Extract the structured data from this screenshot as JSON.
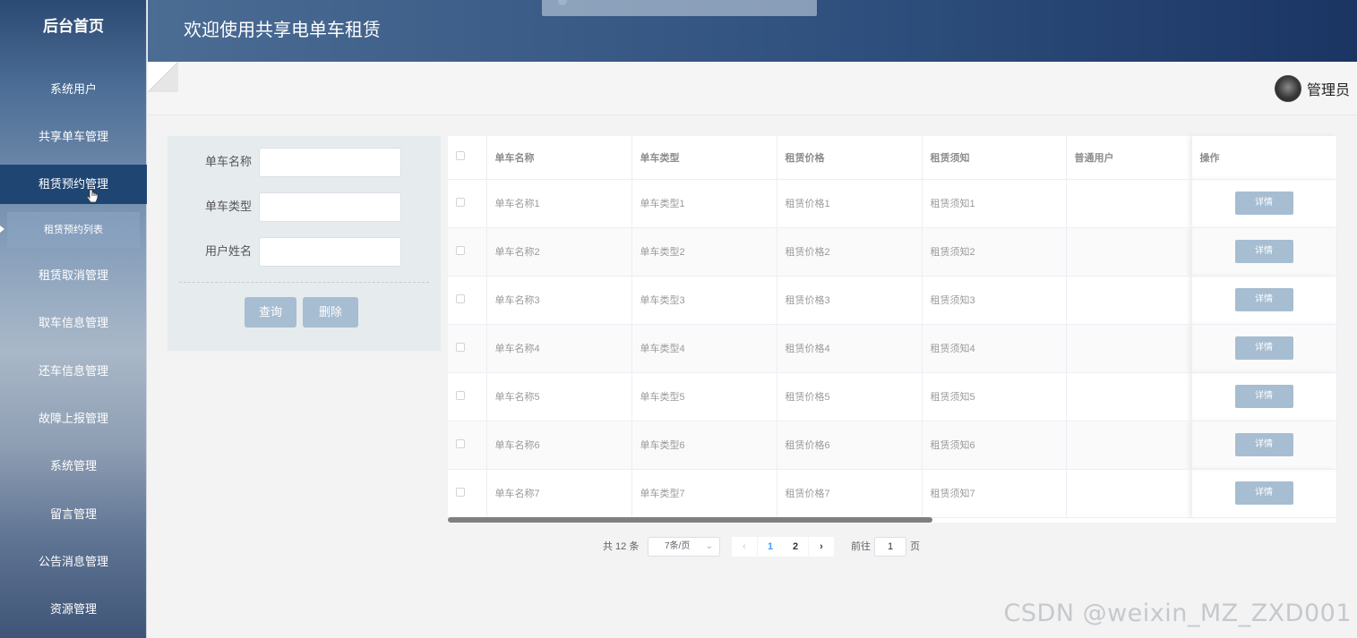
{
  "sidebar": {
    "title": "后台首页",
    "items": [
      {
        "label": "系统用户"
      },
      {
        "label": "共享单车管理"
      },
      {
        "label": "租赁预约管理"
      },
      {
        "label": "租赁取消管理"
      },
      {
        "label": "取车信息管理"
      },
      {
        "label": "还车信息管理"
      },
      {
        "label": "故障上报管理"
      },
      {
        "label": "系统管理"
      },
      {
        "label": "留言管理"
      },
      {
        "label": "公告消息管理"
      },
      {
        "label": "资源管理"
      }
    ],
    "active_index": 2,
    "submenu": {
      "label": "租赁预约列表"
    }
  },
  "header": {
    "title": "欢迎使用共享电单车租赁"
  },
  "topbar": {
    "user_name": "管理员"
  },
  "search": {
    "fields": [
      {
        "label": "单车名称",
        "value": ""
      },
      {
        "label": "单车类型",
        "value": ""
      },
      {
        "label": "用户姓名",
        "value": ""
      }
    ],
    "query_label": "查询",
    "delete_label": "删除"
  },
  "table": {
    "columns": [
      "单车名称",
      "单车类型",
      "租赁价格",
      "租赁须知",
      "普通用户",
      "操作"
    ],
    "rows": [
      {
        "name": "单车名称1",
        "type": "单车类型1",
        "price": "租赁价格1",
        "notice": "租赁须知1",
        "user": ""
      },
      {
        "name": "单车名称2",
        "type": "单车类型2",
        "price": "租赁价格2",
        "notice": "租赁须知2",
        "user": ""
      },
      {
        "name": "单车名称3",
        "type": "单车类型3",
        "price": "租赁价格3",
        "notice": "租赁须知3",
        "user": ""
      },
      {
        "name": "单车名称4",
        "type": "单车类型4",
        "price": "租赁价格4",
        "notice": "租赁须知4",
        "user": ""
      },
      {
        "name": "单车名称5",
        "type": "单车类型5",
        "price": "租赁价格5",
        "notice": "租赁须知5",
        "user": ""
      },
      {
        "name": "单车名称6",
        "type": "单车类型6",
        "price": "租赁价格6",
        "notice": "租赁须知6",
        "user": ""
      },
      {
        "name": "单车名称7",
        "type": "单车类型7",
        "price": "租赁价格7",
        "notice": "租赁须知7",
        "user": ""
      }
    ],
    "detail_label": "详情"
  },
  "pagination": {
    "total_text": "共 12 条",
    "page_size": "7条/页",
    "prev": "‹",
    "next": "›",
    "pages": [
      "1",
      "2"
    ],
    "current": "1",
    "goto_prefix": "前往",
    "goto_value": "1",
    "goto_suffix": "页"
  },
  "watermark": "CSDN @weixin_MZ_ZXD001",
  "colors": {
    "button": "#a7bdd1",
    "active_menu": "#1f4673",
    "header_end": "#1b3563"
  }
}
